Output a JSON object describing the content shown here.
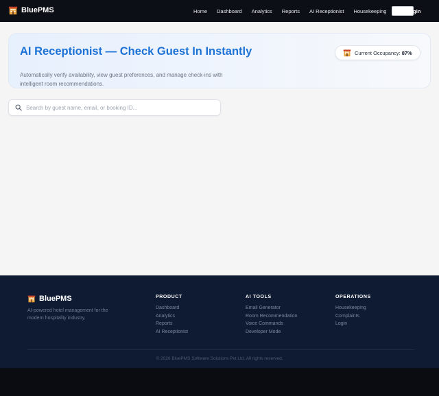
{
  "navbar": {
    "brand_icon": "hotel-icon",
    "brand_name": "BluePMS",
    "links": [
      "Home",
      "Dashboard",
      "Analytics",
      "Reports",
      "AI Receptionist",
      "Housekeeping"
    ],
    "login_label": "Login"
  },
  "hero": {
    "title": "AI Receptionist — Check Guest In Instantly",
    "subtitle": "Automatically verify availability, view guest preferences, and manage check-ins with intelligent room recommendations.",
    "occupancy_icon": "hotel-icon",
    "occupancy_label": "Current Occupancy:",
    "occupancy_value": "87%"
  },
  "search": {
    "icon": "search-icon",
    "placeholder": "Search by guest name, email, or booking ID...",
    "value": ""
  },
  "footer": {
    "brand_name": "BluePMS",
    "tagline": "AI-powered hotel management for the modern hospitality industry.",
    "columns": [
      {
        "heading": "PRODUCT",
        "items": [
          "Dashboard",
          "Analytics",
          "Reports",
          "AI Receptionist"
        ]
      },
      {
        "heading": "AI TOOLS",
        "items": [
          "Email Generator",
          "Room Recommendation",
          "Voice Commands",
          "Developer Mode"
        ]
      },
      {
        "heading": "OPERATIONS",
        "items": [
          "Housekeeping",
          "Complaints",
          "Login"
        ]
      }
    ],
    "copyright": "© 2026 BluePMS Software Solutions Pvt Ltd. All rights reserved."
  },
  "colors": {
    "accent": "#1d72d6",
    "nav_bg": "#0d0f16",
    "footer_bg": "#0e1b33",
    "page_bg": "#f5f5f5"
  }
}
